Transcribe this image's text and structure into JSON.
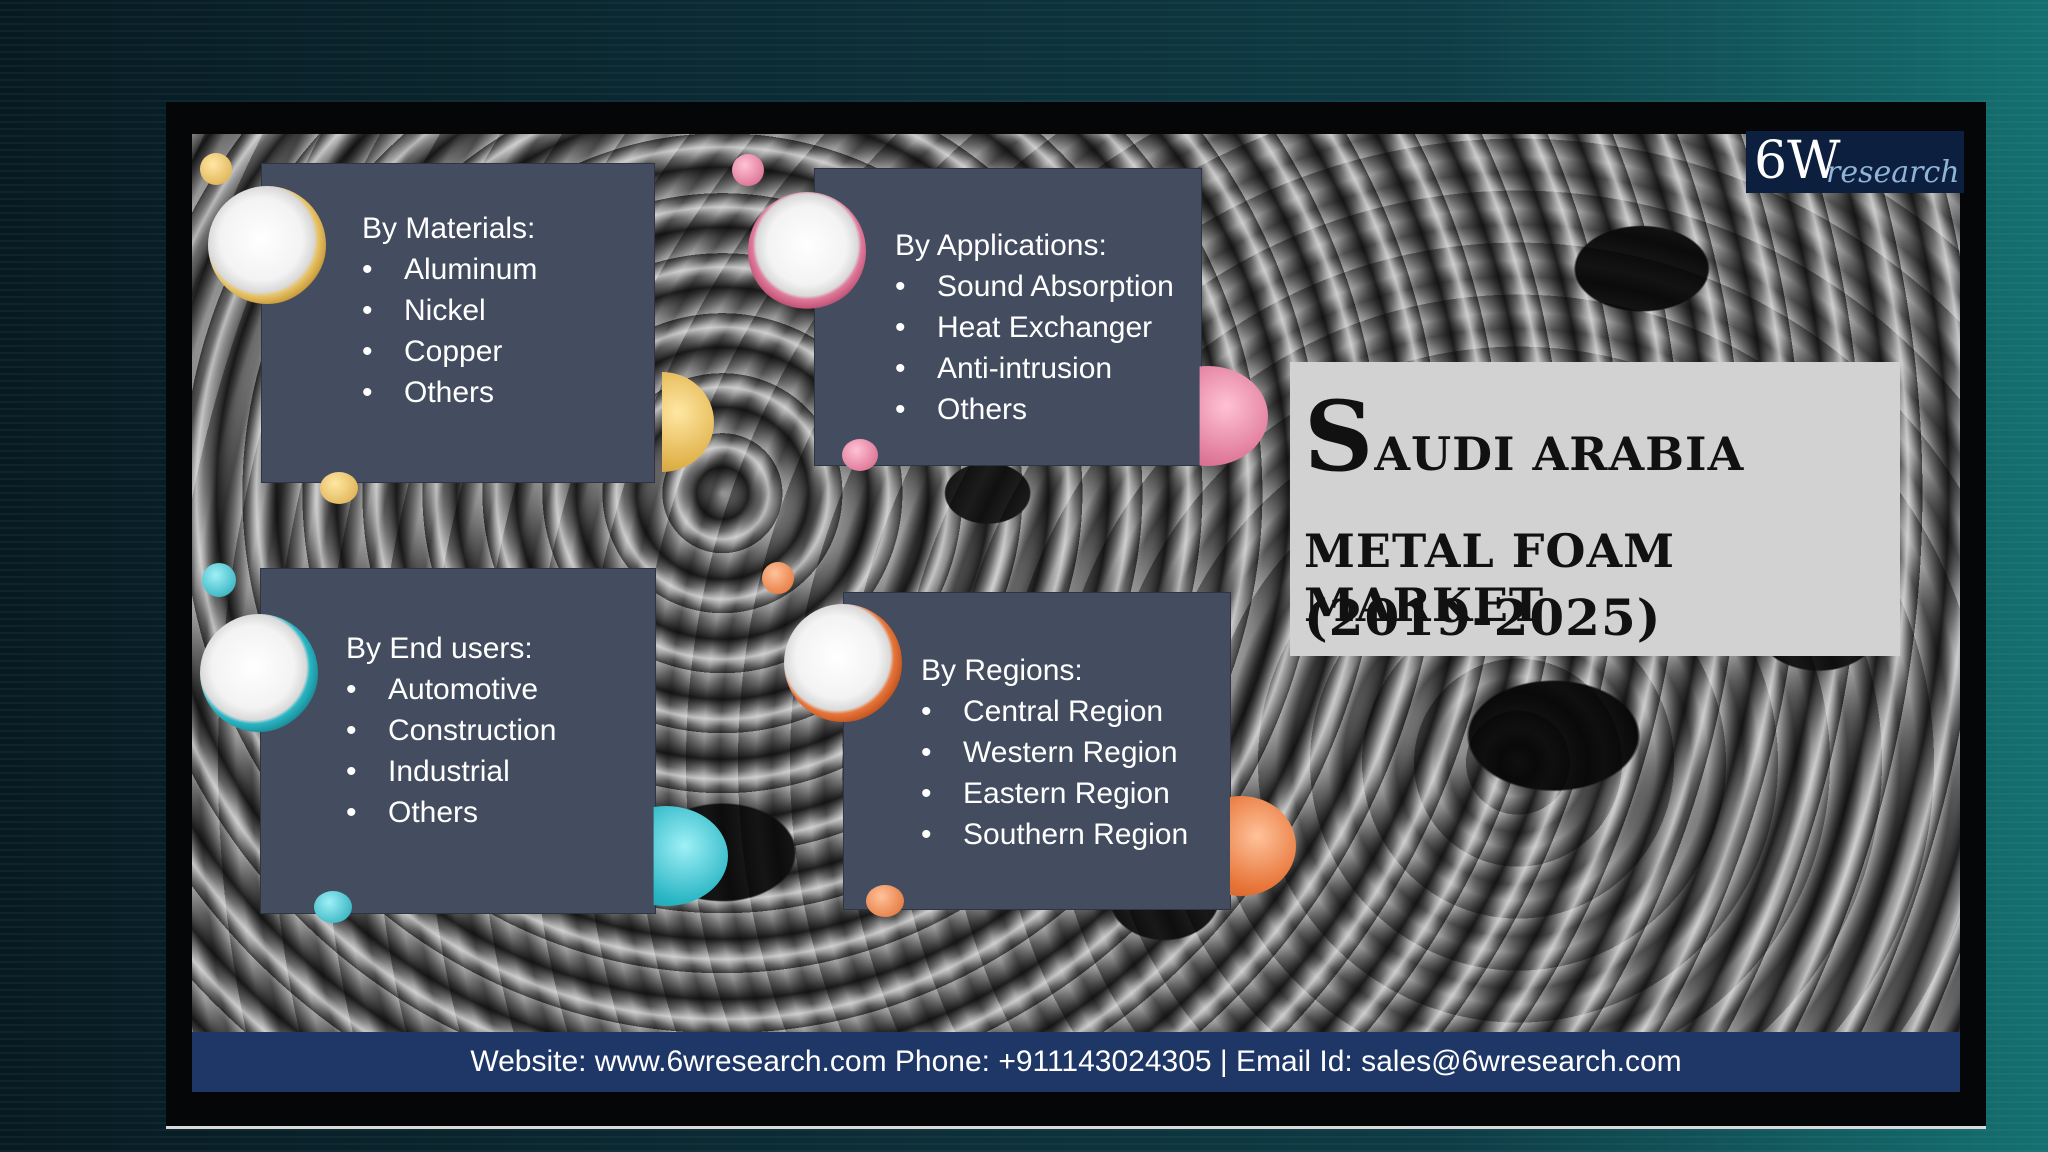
{
  "logo": {
    "six_w": "6W",
    "research": "research"
  },
  "materials": {
    "heading": "By Materials:",
    "items": [
      "Aluminum",
      "Nickel",
      "Copper",
      "Others"
    ]
  },
  "applications": {
    "heading": "By Applications:",
    "items": [
      "Sound Absorption",
      "Heat Exchanger",
      "Anti-intrusion",
      "Others"
    ]
  },
  "end_users": {
    "heading": "By End users:",
    "items": [
      "Automotive",
      "Construction",
      "Industrial",
      "Others"
    ]
  },
  "regions": {
    "heading": "By Regions:",
    "items": [
      "Central Region",
      "Western Region",
      "Eastern Region",
      "Southern Region"
    ]
  },
  "title": {
    "line1_cap": "S",
    "line1_rest": "AUDI ARABIA",
    "line2": "METAL FOAM MARKET",
    "line3": "(2019-2025)"
  },
  "footer": {
    "text": "Website: www.6wresearch.com Phone: +911143024305 | Email Id: sales@6wresearch.com"
  },
  "colors": {
    "gold": "#e8c46a",
    "pink": "#e07a9a",
    "teal": "#2ab6c4",
    "orange": "#e8763a",
    "box": "#434d5f",
    "footer": "#1f3766"
  }
}
